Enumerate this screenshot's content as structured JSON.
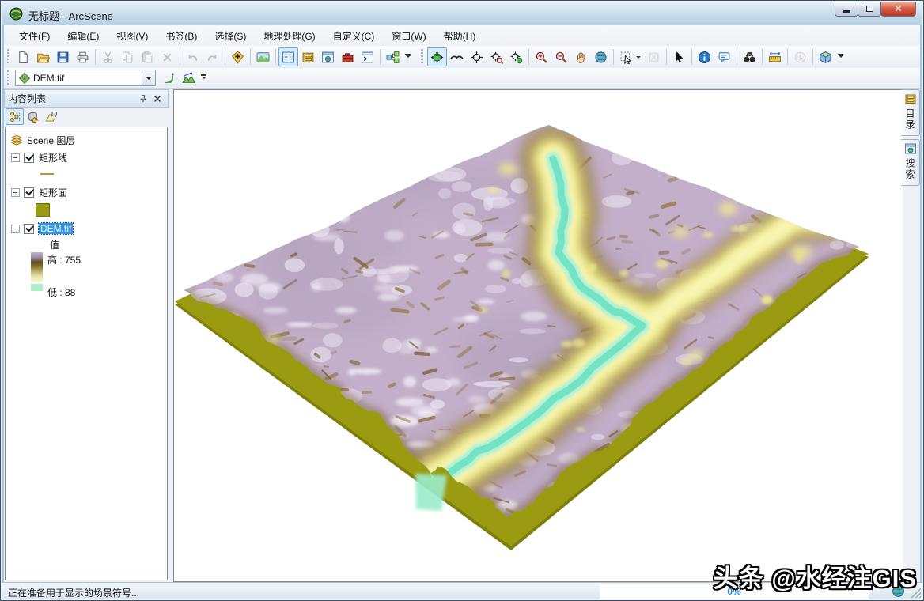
{
  "window": {
    "title": "无标题 - ArcScene",
    "icon": "arcscene-globe-icon",
    "controls": [
      {
        "name": "minimize",
        "icon": "minimize-icon"
      },
      {
        "name": "restore",
        "icon": "restore-icon"
      },
      {
        "name": "close",
        "icon": "close-icon"
      }
    ]
  },
  "menu": [
    "文件(F)",
    "编辑(E)",
    "视图(V)",
    "书签(B)",
    "选择(S)",
    "地理处理(G)",
    "自定义(C)",
    "窗口(W)",
    "帮助(H)"
  ],
  "toolbar_standard": [
    {
      "name": "new-document",
      "icon": "new-document-icon"
    },
    {
      "name": "open",
      "icon": "open-folder-icon"
    },
    {
      "name": "save",
      "icon": "save-icon"
    },
    {
      "name": "print",
      "icon": "print-icon"
    },
    {
      "sep": true
    },
    {
      "name": "cut",
      "icon": "cut-icon",
      "disabled": true
    },
    {
      "name": "copy",
      "icon": "copy-icon",
      "disabled": true
    },
    {
      "name": "paste",
      "icon": "paste-icon",
      "disabled": true
    },
    {
      "name": "delete",
      "icon": "delete-icon",
      "disabled": true
    },
    {
      "sep": true
    },
    {
      "name": "undo",
      "icon": "undo-icon",
      "disabled": true
    },
    {
      "name": "redo",
      "icon": "redo-icon",
      "disabled": true
    },
    {
      "sep": true
    },
    {
      "name": "add-data",
      "icon": "add-data-icon"
    },
    {
      "sep": true
    },
    {
      "name": "scene-properties",
      "icon": "scene-icon"
    },
    {
      "sep": true
    },
    {
      "name": "table-of-contents",
      "icon": "toc-icon",
      "selected": true
    },
    {
      "name": "catalog-window",
      "icon": "catalog-icon"
    },
    {
      "name": "search-window",
      "icon": "search-window-icon"
    },
    {
      "name": "arctoolbox",
      "icon": "toolbox-icon"
    },
    {
      "name": "python-window",
      "icon": "python-window-icon"
    },
    {
      "sep": true
    },
    {
      "name": "modelbuilder",
      "icon": "modelbuilder-icon"
    },
    {
      "overflow": true
    }
  ],
  "toolbar_navigation": [
    {
      "name": "navigate",
      "icon": "navigate-icon",
      "selected": true
    },
    {
      "name": "fly",
      "icon": "fly-icon"
    },
    {
      "name": "center-on-target",
      "icon": "center-target-icon"
    },
    {
      "name": "zoom-to-target",
      "icon": "zoom-target-icon"
    },
    {
      "name": "set-observer",
      "icon": "observer-target-icon"
    },
    {
      "sep": true
    },
    {
      "name": "zoom-in",
      "icon": "zoom-in-icon"
    },
    {
      "name": "zoom-out",
      "icon": "zoom-out-icon"
    },
    {
      "name": "pan",
      "icon": "pan-icon"
    },
    {
      "name": "full-extent",
      "icon": "full-extent-icon"
    },
    {
      "sep": true
    },
    {
      "name": "select-graphics",
      "icon": "select-graphics-icon",
      "dropdown": true
    },
    {
      "name": "select-by-box",
      "icon": "select-box-icon",
      "disabled": true
    },
    {
      "sep": true
    },
    {
      "name": "select-elements",
      "icon": "pointer-icon"
    },
    {
      "sep": true
    },
    {
      "name": "identify",
      "icon": "identify-icon"
    },
    {
      "name": "html-popup",
      "icon": "html-popup-icon"
    },
    {
      "sep": true
    },
    {
      "name": "find",
      "icon": "find-icon"
    },
    {
      "sep": true
    },
    {
      "name": "measure",
      "icon": "measure-icon"
    },
    {
      "sep": true
    },
    {
      "name": "animation",
      "icon": "animation-icon",
      "disabled": true
    },
    {
      "sep": true
    },
    {
      "name": "viewer-manager",
      "icon": "viewer-3d-icon"
    },
    {
      "overflow": true
    }
  ],
  "layer_toolbar": {
    "combo_value": "DEM.tif",
    "combo_icon": "layer-diamond-icon",
    "buttons": [
      {
        "name": "steepest-path",
        "icon": "steepest-path-icon"
      },
      {
        "name": "line-of-sight",
        "icon": "line-of-sight-icon"
      },
      {
        "overflow": true
      }
    ]
  },
  "toc": {
    "title": "内容列表",
    "header_buttons": [
      {
        "name": "auto-hide",
        "icon": "pin-icon"
      },
      {
        "name": "close-panel",
        "icon": "close-x-icon"
      }
    ],
    "buttons": [
      {
        "name": "list-by-drawing-order",
        "icon": "list-by-drawing-order-icon",
        "selected": true
      },
      {
        "name": "list-by-source",
        "icon": "list-by-source-icon"
      },
      {
        "name": "list-by-visibility",
        "icon": "list-by-visibility-icon"
      }
    ],
    "root": {
      "label": "Scene 图层",
      "icon": "layers-icon"
    },
    "layers": [
      {
        "label": "矩形线",
        "checked": true,
        "symbol": "line",
        "symbol_color": "#b09a28"
      },
      {
        "label": "矩形面",
        "checked": true,
        "symbol": "fill",
        "symbol_color": "#9a9b10"
      },
      {
        "label": "DEM.tif",
        "checked": true,
        "selected": true,
        "field_label": "值",
        "legend": {
          "high_label": "高 : 755",
          "low_label": "低 : 88",
          "ramp_colors": [
            "#c6b0d2",
            "#9c92a6",
            "#5e5024",
            "#8a7830",
            "#c0b478",
            "#ece7a6",
            "#f6f3c8"
          ],
          "low_chip_color": "#aeeec8"
        }
      }
    ]
  },
  "scene": {
    "terrain_colors": {
      "base_platform": "#9a9b10",
      "base_edge": "#7e7f0c",
      "surface_high": "#c3afc9",
      "surface_highlight": "#f2ebf7",
      "ridge_shadow": "#8a6f2e",
      "ridge_dark": "#6e5820",
      "valley": "#f2ee8e",
      "water": "#6fe2c2"
    }
  },
  "dock_tabs": [
    {
      "label": "目录",
      "icon": "catalog-icon"
    },
    {
      "label": "搜索",
      "icon": "search-window-icon"
    }
  ],
  "status_bar": {
    "message": "正在准备用于显示的场景符号...",
    "progress": "0%",
    "globe_icon": "globe-icon"
  },
  "watermark": "头条 @水经注GIS"
}
